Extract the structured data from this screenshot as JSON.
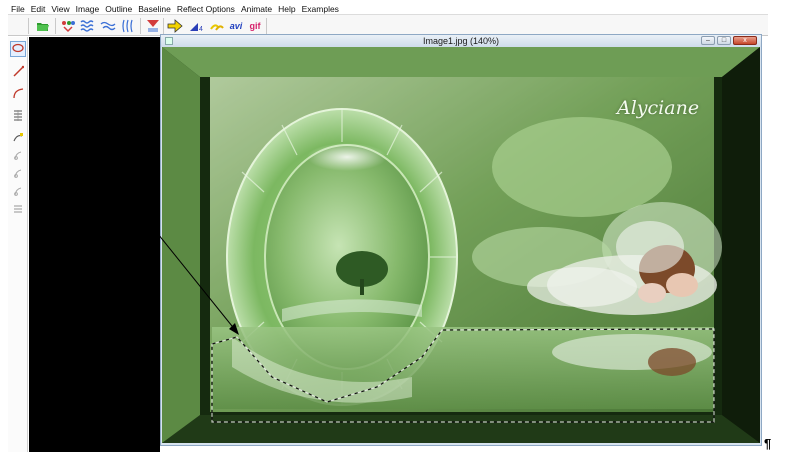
{
  "menu": {
    "items": [
      "File",
      "Edit",
      "View",
      "Image",
      "Outline",
      "Baseline",
      "Reflect Options",
      "Animate",
      "Help",
      "Examples"
    ]
  },
  "toolbar": {
    "buttons": [
      {
        "name": "open-icon",
        "color": "#2e9b2e"
      },
      {
        "name": "color-dots-icon",
        "color": "#d23c3c"
      },
      {
        "name": "water-waves-icon",
        "color": "#3a6fd6"
      },
      {
        "name": "wind-waves-icon",
        "color": "#3a6fd6"
      },
      {
        "name": "wave-lines-icon",
        "color": "#3a6fd6"
      },
      {
        "name": "grid-mask-icon",
        "color": "#d23c3c"
      },
      {
        "name": "arrow-right-icon",
        "color": "#e8c800"
      },
      {
        "name": "wedge-icon",
        "color": "#2b3fb8"
      },
      {
        "name": "brush-strokes-icon",
        "color": "#e8c800"
      }
    ],
    "avi_label": "avi",
    "gif_label": "gif",
    "avi_color": "#1f3fbf",
    "gif_color": "#d6206a"
  },
  "palette": {
    "tools": [
      "lasso-icon",
      "line-tool-icon",
      "curve-tool-icon",
      "spring-icon",
      "edit-node-icon",
      "node-icon-1",
      "node-icon-2",
      "node-icon-3",
      "stack-icon"
    ],
    "accent": "#c0392b"
  },
  "image_window": {
    "title": "Image1.jpg  (140%)",
    "min_label": "–",
    "max_label": "□",
    "close_label": "x"
  },
  "image": {
    "signature_text": "Alyciane"
  },
  "document": {
    "paragraph_mark": "¶"
  }
}
